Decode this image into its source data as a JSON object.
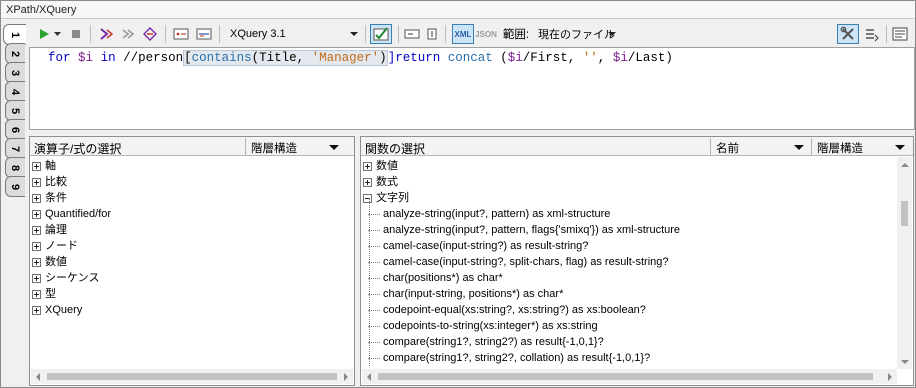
{
  "window": {
    "title": "XPath/XQuery"
  },
  "tabs": [
    "1",
    "2",
    "3",
    "4",
    "5",
    "6",
    "7",
    "8",
    "9"
  ],
  "toolbar": {
    "version_select": "XQuery 3.1",
    "xml_label": "XML",
    "json_label": "JSON",
    "scope_label": "範囲:",
    "scope_value": "現在のファイル"
  },
  "editor": {
    "code": {
      "for": "for",
      "var_i": "$i",
      "in": "in",
      "path": "//person",
      "contains": "contains",
      "title_arg": "(Title, ",
      "manager": "'Manager'",
      "close_paren": ")",
      "return": "]return",
      "concat": "concat",
      "concat_open": " (",
      "first": "/First, ",
      "empty": "''",
      "comma": ", ",
      "last": "/Last)"
    }
  },
  "operators_panel": {
    "title": "演算子/式の選択",
    "view_select": "階層構造",
    "items": [
      "軸",
      "比較",
      "条件",
      "Quantified/for",
      "論理",
      "ノード",
      "数値",
      "シーケンス",
      "型",
      "XQuery"
    ]
  },
  "functions_panel": {
    "title": "関数の選択",
    "name_select": "名前",
    "view_select": "階層構造",
    "groups": {
      "numeric": "数値",
      "math": "数式",
      "string": "文字列"
    },
    "string_functions": [
      "analyze-string(input?, pattern) as xml-structure",
      "analyze-string(input?, pattern, flags{'smixq'}) as xml-structure",
      "camel-case(input-string?) as result-string?",
      "camel-case(input-string?, split-chars, flag) as result-string?",
      "char(positions*) as char*",
      "char(input-string, positions*) as char*",
      "codepoint-equal(xs:string?, xs:string?) as xs:boolean?",
      "codepoints-to-string(xs:integer*) as xs:string",
      "compare(string1?, string2?) as result{-1,0,1}?",
      "compare(string1?, string2?, collation) as result{-1,0,1}?"
    ]
  },
  "colors": {
    "keyword": "#0000c8",
    "variable": "#7a1e8e",
    "function": "#2a6faa",
    "string": "#c06a1a",
    "run_green": "#2ca02c"
  }
}
